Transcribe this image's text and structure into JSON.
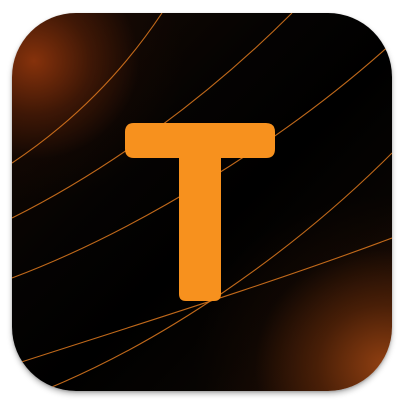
{
  "app_icon": {
    "letter": "T",
    "letter_color": "#F7911E",
    "background_color": "#000000",
    "glow_color": "#9A3E0E",
    "line_color": "#E07A1F"
  }
}
